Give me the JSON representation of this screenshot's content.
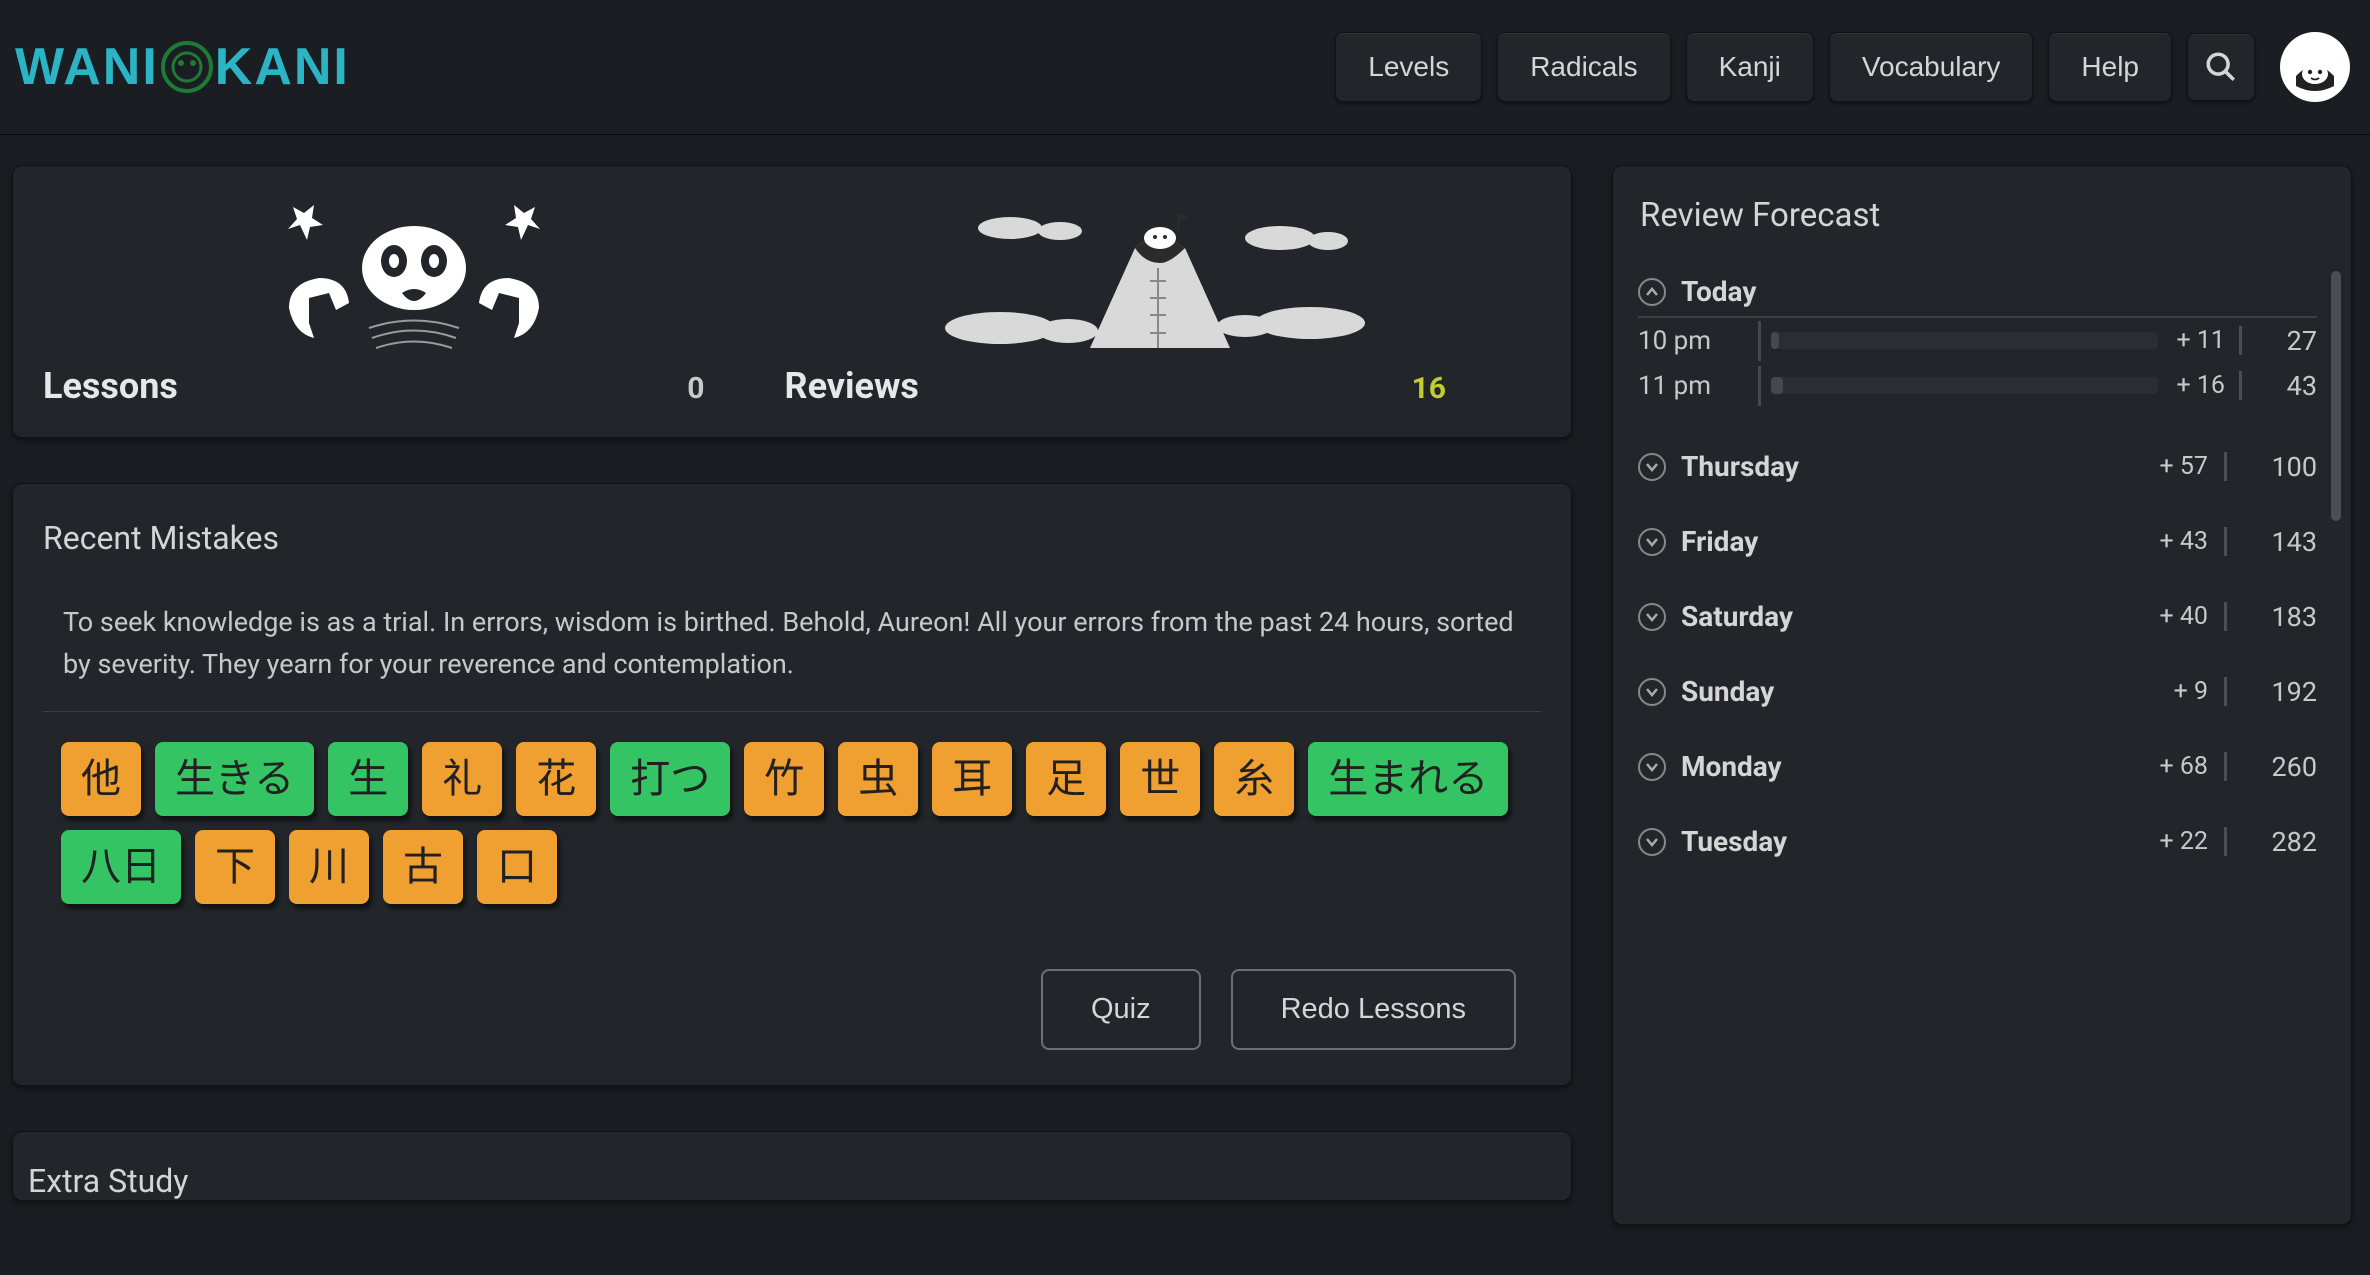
{
  "brand": {
    "left": "WANI",
    "right": "KANI"
  },
  "nav": {
    "levels": "Levels",
    "radicals": "Radicals",
    "kanji": "Kanji",
    "vocabulary": "Vocabulary",
    "help": "Help"
  },
  "hero": {
    "lessons_label": "Lessons",
    "lessons_count": "0",
    "reviews_label": "Reviews",
    "reviews_count": "16"
  },
  "mistakes": {
    "title": "Recent Mistakes",
    "description": "To seek knowledge is as a trial. In errors, wisdom is birthed. Behold, Aureon! All your errors from the past 24 hours, sorted by severity. They yearn for your reverence and contemplation.",
    "tiles": [
      {
        "text": "他",
        "type": "kanji"
      },
      {
        "text": "生きる",
        "type": "vocab"
      },
      {
        "text": "生",
        "type": "vocab"
      },
      {
        "text": "礼",
        "type": "kanji"
      },
      {
        "text": "花",
        "type": "kanji"
      },
      {
        "text": "打つ",
        "type": "vocab"
      },
      {
        "text": "竹",
        "type": "kanji"
      },
      {
        "text": "虫",
        "type": "kanji"
      },
      {
        "text": "耳",
        "type": "kanji"
      },
      {
        "text": "足",
        "type": "kanji"
      },
      {
        "text": "世",
        "type": "kanji"
      },
      {
        "text": "糸",
        "type": "kanji"
      },
      {
        "text": "生まれる",
        "type": "vocab"
      },
      {
        "text": "八日",
        "type": "vocab"
      },
      {
        "text": "下",
        "type": "kanji"
      },
      {
        "text": "川",
        "type": "kanji"
      },
      {
        "text": "古",
        "type": "kanji"
      },
      {
        "text": "口",
        "type": "kanji"
      }
    ],
    "quiz_btn": "Quiz",
    "redo_btn": "Redo Lessons"
  },
  "extra": {
    "title": "Extra Study"
  },
  "forecast": {
    "title": "Review Forecast",
    "days": [
      {
        "name": "Today",
        "expanded": true,
        "hours": [
          {
            "time": "10 pm",
            "plus": "+ 11",
            "total": "27",
            "pct": 2
          },
          {
            "time": "11 pm",
            "plus": "+ 16",
            "total": "43",
            "pct": 3
          }
        ]
      },
      {
        "name": "Thursday",
        "expanded": false,
        "plus": "+ 57",
        "total": "100"
      },
      {
        "name": "Friday",
        "expanded": false,
        "plus": "+ 43",
        "total": "143"
      },
      {
        "name": "Saturday",
        "expanded": false,
        "plus": "+ 40",
        "total": "183"
      },
      {
        "name": "Sunday",
        "expanded": false,
        "plus": "+ 9",
        "total": "192"
      },
      {
        "name": "Monday",
        "expanded": false,
        "plus": "+ 68",
        "total": "260"
      },
      {
        "name": "Tuesday",
        "expanded": false,
        "plus": "+ 22",
        "total": "282"
      }
    ]
  }
}
